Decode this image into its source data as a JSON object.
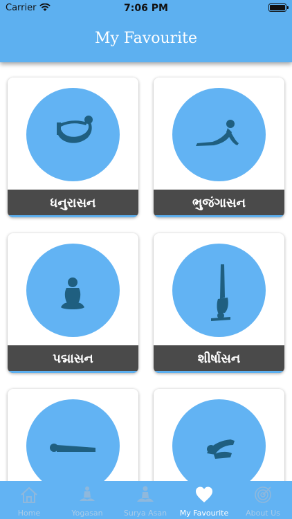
{
  "status_bar": {
    "carrier": "Carrier",
    "time": "7:06 PM"
  },
  "header": {
    "title": "My Favourite"
  },
  "cards": [
    {
      "label": "ધનુરાસન",
      "pose_icon": "dhanurasana-pose-icon"
    },
    {
      "label": "ભુજંગાસન",
      "pose_icon": "bhujangasana-pose-icon"
    },
    {
      "label": "પદ્માસન",
      "pose_icon": "padmasana-pose-icon"
    },
    {
      "label": "શીર્ષાસન",
      "pose_icon": "shirshasana-pose-icon"
    },
    {
      "label": "",
      "pose_icon": "prone-pose-icon"
    },
    {
      "label": "",
      "pose_icon": "kneeling-pose-icon"
    }
  ],
  "tabbar": {
    "tabs": [
      {
        "label": "Home",
        "icon": "home-icon",
        "active": false
      },
      {
        "label": "Yogasan",
        "icon": "meditation-icon",
        "active": false
      },
      {
        "label": "Surya Asan",
        "icon": "surya-asan-icon",
        "active": false
      },
      {
        "label": "My Favourite",
        "icon": "heart-icon",
        "active": true
      },
      {
        "label": "About Us",
        "icon": "target-icon",
        "active": false
      }
    ]
  },
  "colors": {
    "accent": "#5db0f0",
    "circle": "#62b3f3",
    "label_bg": "#4a4a4a",
    "silhouette": "#1f5f80"
  }
}
